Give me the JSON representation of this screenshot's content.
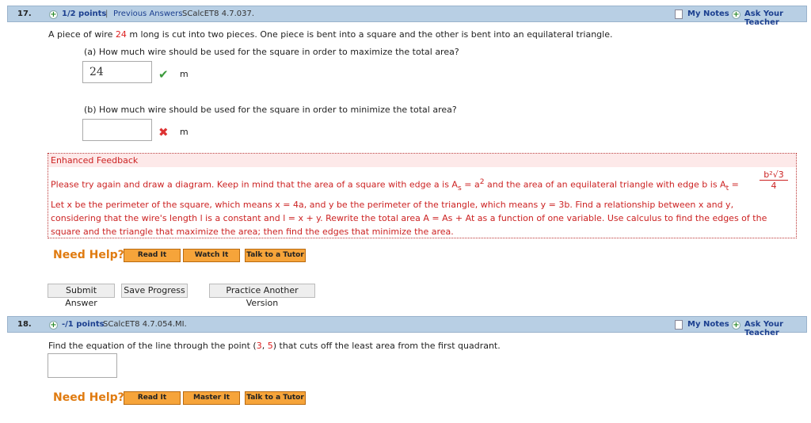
{
  "q17": {
    "number": "17.",
    "points": "1/2 points",
    "separator": "|",
    "previous_answers": "Previous Answers",
    "code": "SCalcET8 4.7.037.",
    "my_notes": "My Notes",
    "ask_teacher": "Ask Your Teacher",
    "prompt_pre": "A piece of wire ",
    "prompt_num": "24",
    "prompt_post": " m long is cut into two pieces. One piece is bent into a square and the other is bent into an equilateral triangle.",
    "part_a": "(a) How much wire should be used for the square in order to maximize the total area?",
    "answer_a": "24",
    "unit_a": "m",
    "part_b": "(b) How much wire should be used for the square in order to minimize the total area?",
    "answer_b": "",
    "unit_b": "m",
    "feedback_title": "Enhanced Feedback",
    "feedback_l1a": "Please try again and draw a diagram. Keep in mind that the area of a square with edge a is A",
    "feedback_l1b": "s",
    "feedback_l1c": " = a",
    "feedback_l1d": "2",
    "feedback_l1e": " and the area of an equilateral triangle with edge b is A",
    "feedback_l1f": "t",
    "feedback_l1g": " =",
    "feedback_frac_num": "b²√3",
    "feedback_frac_den": "4",
    "feedback_l2": "Let x be the perimeter of the square, which means  x = 4a,  and y be the perimeter of the triangle, which means  y = 3b.  Find a relationship between x and y,",
    "feedback_l3": "considering that the wire's length l is a constant and  l = x + y.  Rewrite the total area  A = As + At  as a function of one variable. Use calculus to find the edges of the",
    "feedback_l4": "square and the triangle that maximize the area; then find the edges that minimize the area.",
    "need_help": "Need Help?",
    "read_it": "Read It",
    "watch_it": "Watch It",
    "talk_tutor": "Talk to a Tutor",
    "submit": "Submit Answer",
    "save": "Save Progress",
    "practice": "Practice Another Version"
  },
  "q18": {
    "number": "18.",
    "points": "-/1 points",
    "code": "SCalcET8 4.7.054.MI.",
    "my_notes": "My Notes",
    "ask_teacher": "Ask Your Teacher",
    "prompt_pre": "Find the equation of the line through the point (",
    "p1": "3",
    "comma": ", ",
    "p2": "5",
    "prompt_post": ") that cuts off the least area from the first quadrant.",
    "answer": "",
    "need_help": "Need Help?",
    "read_it": "Read It",
    "master_it": "Master It",
    "talk_tutor": "Talk to a Tutor"
  }
}
